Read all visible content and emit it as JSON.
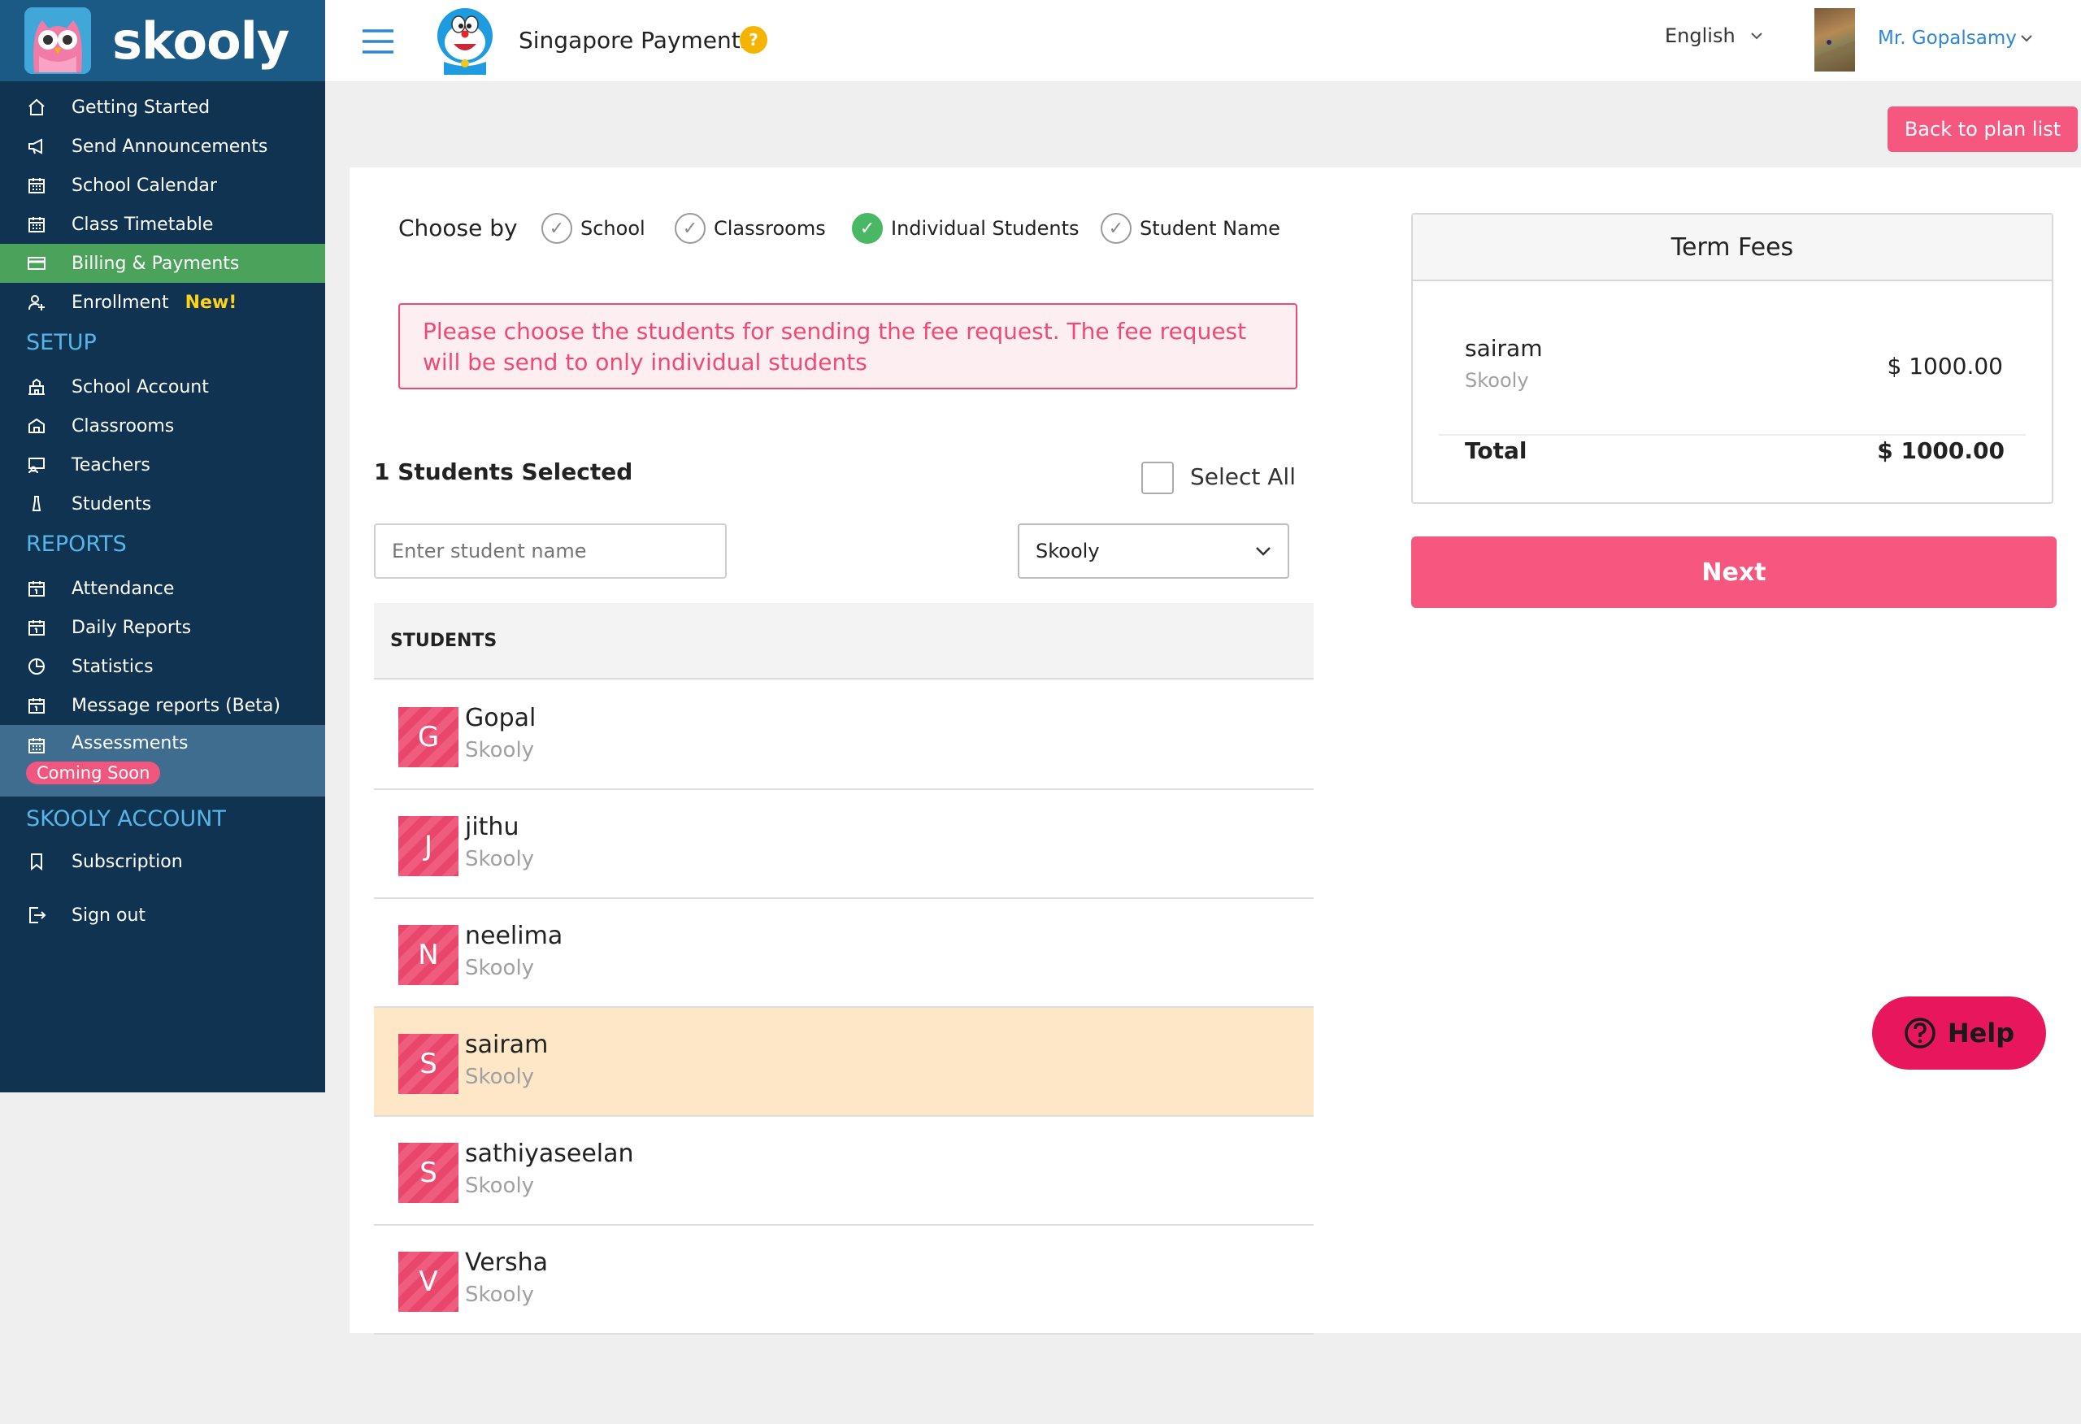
{
  "app": {
    "logo_text": "skooly"
  },
  "sidebar": {
    "items": [
      {
        "label": "Getting Started",
        "icon": "home-icon"
      },
      {
        "label": "Send Announcements",
        "icon": "megaphone-icon"
      },
      {
        "label": "School Calendar",
        "icon": "calendar-icon"
      },
      {
        "label": "Class Timetable",
        "icon": "calendar-icon"
      },
      {
        "label": "Billing & Payments",
        "icon": "card-icon",
        "active": true
      },
      {
        "label": "Enrollment",
        "icon": "user-plus-icon",
        "badge": "New!"
      }
    ],
    "setup_title": "SETUP",
    "setup_items": [
      {
        "label": "School Account",
        "icon": "school-icon"
      },
      {
        "label": "Classrooms",
        "icon": "classroom-icon"
      },
      {
        "label": "Teachers",
        "icon": "teacher-icon"
      },
      {
        "label": "Students",
        "icon": "student-icon"
      }
    ],
    "reports_title": "REPORTS",
    "reports_items": [
      {
        "label": "Attendance",
        "icon": "calendar-one-icon"
      },
      {
        "label": "Daily Reports",
        "icon": "calendar-one-icon"
      },
      {
        "label": "Statistics",
        "icon": "pie-chart-icon"
      },
      {
        "label": "Message reports (Beta)",
        "icon": "calendar-one-icon"
      },
      {
        "label": "Assessments",
        "icon": "calendar-icon",
        "badge": "Coming Soon"
      }
    ],
    "account_title": "SKOOLY ACCOUNT",
    "account_items": [
      {
        "label": "Subscription",
        "icon": "bookmark-icon"
      },
      {
        "label": "Sign out",
        "icon": "sign-out-icon"
      }
    ]
  },
  "header": {
    "school_name": "Singapore Payments",
    "help_badge": "?",
    "language": "English",
    "user_name": "Mr. Gopalsamy"
  },
  "actions": {
    "back_label": "Back to plan list",
    "next_label": "Next",
    "help_label": "Help"
  },
  "choose_by": {
    "label": "Choose by",
    "options": [
      {
        "label": "School",
        "selected": false
      },
      {
        "label": "Classrooms",
        "selected": false
      },
      {
        "label": "Individual Students",
        "selected": true
      },
      {
        "label": "Student Name",
        "selected": false
      }
    ]
  },
  "alert": {
    "text": "Please choose the students for sending the fee request. The fee request will be send to only individual students"
  },
  "students": {
    "selected_count": "1 Students Selected",
    "select_all_label": "Select All",
    "search_placeholder": "Enter student name",
    "school_filter": "Skooly",
    "column_header": "STUDENTS",
    "rows": [
      {
        "initial": "G",
        "name": "Gopal",
        "school": "Skooly",
        "selected": false
      },
      {
        "initial": "J",
        "name": "jithu",
        "school": "Skooly",
        "selected": false
      },
      {
        "initial": "N",
        "name": "neelima",
        "school": "Skooly",
        "selected": false
      },
      {
        "initial": "S",
        "name": "sairam",
        "school": "Skooly",
        "selected": true
      },
      {
        "initial": "S",
        "name": "sathiyaseelan",
        "school": "Skooly",
        "selected": false
      },
      {
        "initial": "V",
        "name": "Versha",
        "school": "Skooly",
        "selected": false
      }
    ]
  },
  "fees": {
    "title": "Term Fees",
    "item_name": "sairam",
    "item_school": "Skooly",
    "item_amount": "$ 1000.00",
    "total_label": "Total",
    "total_amount": "$ 1000.00"
  },
  "colors": {
    "sidebar_bg": "#0f3350",
    "active_green": "#4ba35b",
    "brand_pink": "#f5577f",
    "help_pink": "#e8175d",
    "selected_row": "#fde7c7"
  }
}
